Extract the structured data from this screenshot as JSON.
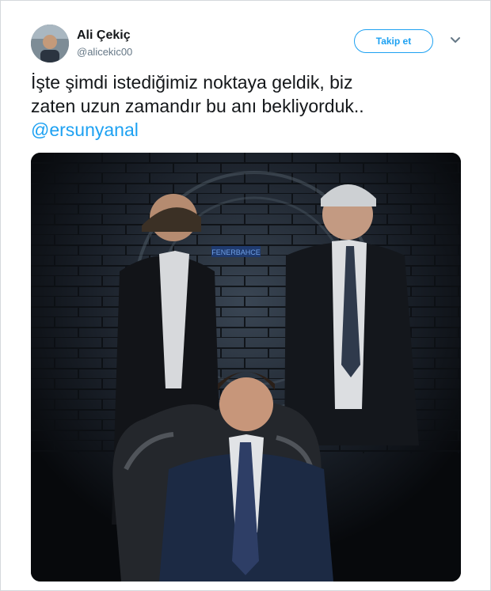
{
  "user": {
    "display_name": "Ali Çekiç",
    "handle": "@alicekic00",
    "avatar_icon": "user-avatar-photo"
  },
  "actions": {
    "follow_label": "Takip et",
    "more_icon": "chevron-down-icon"
  },
  "tweet": {
    "line1": "İşte şimdi istediğimiz noktaya geldik, biz",
    "line2": "zaten uzun zamandır bu anı bekliyorduk..",
    "mention": "@ersunyanal"
  },
  "media": {
    "sign_text": "FENERBAHCE"
  },
  "colors": {
    "accent": "#1da1f2",
    "text": "#14171a",
    "muted": "#657786"
  }
}
